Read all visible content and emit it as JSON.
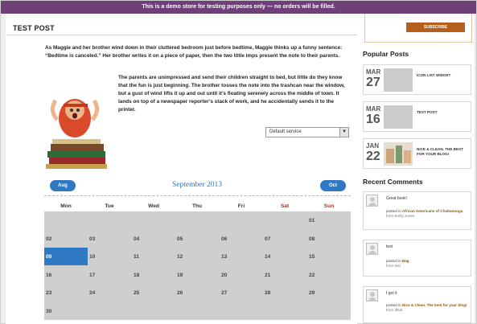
{
  "notice": "This is a demo store for testing purposes only — no orders will be filled.",
  "post": {
    "title": "TEST POST",
    "paragraph1": "As Maggie and her brother wind down in their cluttered bedroom just before bedtime, Maggie thinks up a funny sentence: “Bedtime is canceled.” Her brother writes it on a piece of paper, then the two little imps present the note to their parents.",
    "paragraph2": "The parents are unimpressed and send their children straight to bed, but little do they know that the fun is just beginning. The brother tosses the note into the trashcan near the window, but a gust of wind lifts it up and out until it’s floating serenely across the middle of town. It lands on top of a newspaper reporter’s stack of work, and he accidentally sends it to the printer.",
    "select_value": "Default service"
  },
  "calendar": {
    "title": "September 2013",
    "prev_label": "Aug",
    "next_label": "Oct",
    "weekdays": [
      "Mon",
      "Tue",
      "Wed",
      "Thu",
      "Fri",
      "Sat",
      "Sun"
    ],
    "weeks": [
      [
        "",
        "",
        "",
        "",
        "",
        "",
        "01"
      ],
      [
        "02",
        "03",
        "04",
        "05",
        "06",
        "07",
        "08"
      ],
      [
        "09",
        "10",
        "11",
        "12",
        "13",
        "14",
        "15"
      ],
      [
        "16",
        "17",
        "18",
        "19",
        "20",
        "21",
        "22"
      ],
      [
        "23",
        "24",
        "25",
        "26",
        "27",
        "28",
        "29"
      ],
      [
        "30",
        "",
        "",
        "",
        "",
        "",
        ""
      ]
    ],
    "selected_day": "09",
    "colors": {
      "accent": "#2f79c2",
      "weekend": "#b32a2a",
      "grid": "#cfcfcf"
    }
  },
  "sidebar": {
    "subscribe_label": "SUBSCRIBE",
    "popular_title": "Popular Posts",
    "popular_posts": [
      {
        "month": "MAR",
        "day": "27",
        "title": "ICON LIST WIDGET"
      },
      {
        "month": "MAR",
        "day": "16",
        "title": "TEST POST"
      },
      {
        "month": "JAN",
        "day": "22",
        "title": "NICE & CLEAN. THE BEST FOR YOUR BLOG!"
      }
    ],
    "recent_title": "Recent Comments",
    "recent_comments": [
      {
        "quote": "Great book!",
        "posted_in": "posted in",
        "post_link": "African Americans of Chattanooga",
        "from_label": "from",
        "author": "Emily Jones"
      },
      {
        "quote": "test",
        "posted_in": "posted in",
        "post_link": "Bag",
        "from_label": "from",
        "author": "test"
      },
      {
        "quote": "I got it",
        "posted_in": "posted in",
        "post_link": "Nice & Clean. The best for your blog!",
        "from_label": "from",
        "author": "dfsdr"
      }
    ]
  },
  "colors": {
    "notice_bar": "#6e3f78",
    "subscribe_button": "#b45f1c"
  }
}
